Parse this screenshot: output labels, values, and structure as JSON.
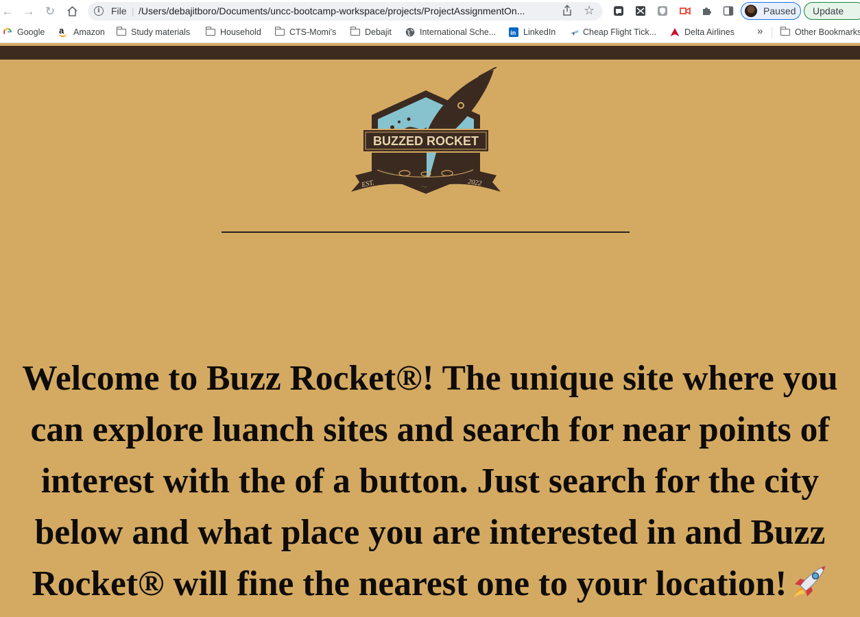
{
  "browser": {
    "omnibox": {
      "scheme": "File",
      "separator": "|",
      "url": "/Users/debajitboro/Documents/uncc-bootcamp-workspace/projects/ProjectAssignmentOn..."
    },
    "profile": {
      "label": "Paused"
    },
    "update_button": {
      "label": "Update"
    },
    "bookmarks": [
      {
        "label": "Google",
        "icon": "google-icon"
      },
      {
        "label": "Amazon",
        "icon": "amazon-icon"
      },
      {
        "label": "Study materials",
        "icon": "folder-icon"
      },
      {
        "label": "Household",
        "icon": "folder-icon"
      },
      {
        "label": "CTS-Momi's",
        "icon": "folder-icon"
      },
      {
        "label": "Debajit",
        "icon": "folder-icon"
      },
      {
        "label": "International Sche...",
        "icon": "globe-icon"
      },
      {
        "label": "LinkedIn",
        "icon": "linkedin-icon"
      },
      {
        "label": "Cheap Flight Tick...",
        "icon": "plane-icon"
      },
      {
        "label": "Delta Airlines",
        "icon": "delta-icon"
      }
    ],
    "bookmarks_overflow": "»",
    "other_bookmarks": {
      "label": "Other Bookmarks",
      "icon": "folder-icon"
    }
  },
  "page": {
    "logo": {
      "brand_text": "BUZZED ROCKET",
      "est_text": "EST.",
      "year_text": "2022"
    },
    "welcome_text": "Welcome to Buzz Rocket®! The unique site where you can explore luanch sites and search for near points of interest with the of a button. Just search for the city below and what place you are interested in and Buzz Rocket® will fine the nearest one to your location!",
    "colors": {
      "background": "#d4aa62",
      "header_bar": "#3d2b20",
      "text": "#0e0b09",
      "logo_brown": "#3b2a20",
      "logo_sky": "#86c3cf"
    }
  }
}
